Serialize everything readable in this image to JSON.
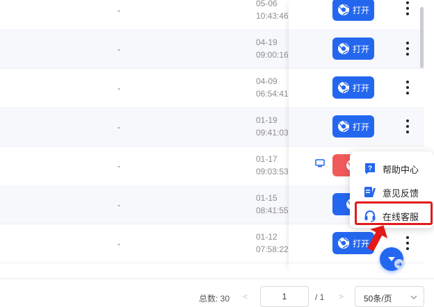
{
  "rows": [
    {
      "dash": "-",
      "date": "05-06",
      "time": "10:43:46",
      "action": "打开"
    },
    {
      "dash": "-",
      "date": "04-19",
      "time": "09:00:16",
      "action": "打开"
    },
    {
      "dash": "-",
      "date": "04-09",
      "time": "06:54:41",
      "action": "打开"
    },
    {
      "dash": "-",
      "date": "01-19",
      "time": "09:41:03",
      "action": "打开"
    },
    {
      "dash": "-",
      "date": "01-17",
      "time": "09:03:53",
      "action": ""
    },
    {
      "dash": "-",
      "date": "01-15",
      "time": "08:41:55",
      "action": ""
    },
    {
      "dash": "-",
      "date": "01-12",
      "time": "07:58:22",
      "action": "打开"
    }
  ],
  "pagination": {
    "total": "总数: 30",
    "prev": "<",
    "current_page": "1",
    "of_pages": "/ 1",
    "next": ">",
    "page_size": "50条/页"
  },
  "help_popup": {
    "items": [
      {
        "label": "帮助中心",
        "icon": "question-icon"
      },
      {
        "label": "意见反馈",
        "icon": "feedback-icon"
      },
      {
        "label": "在线客服",
        "icon": "headset-icon"
      }
    ]
  },
  "colors": {
    "primary": "#2467ef",
    "danger": "#f05a5a",
    "highlight": "#e21a1a"
  }
}
